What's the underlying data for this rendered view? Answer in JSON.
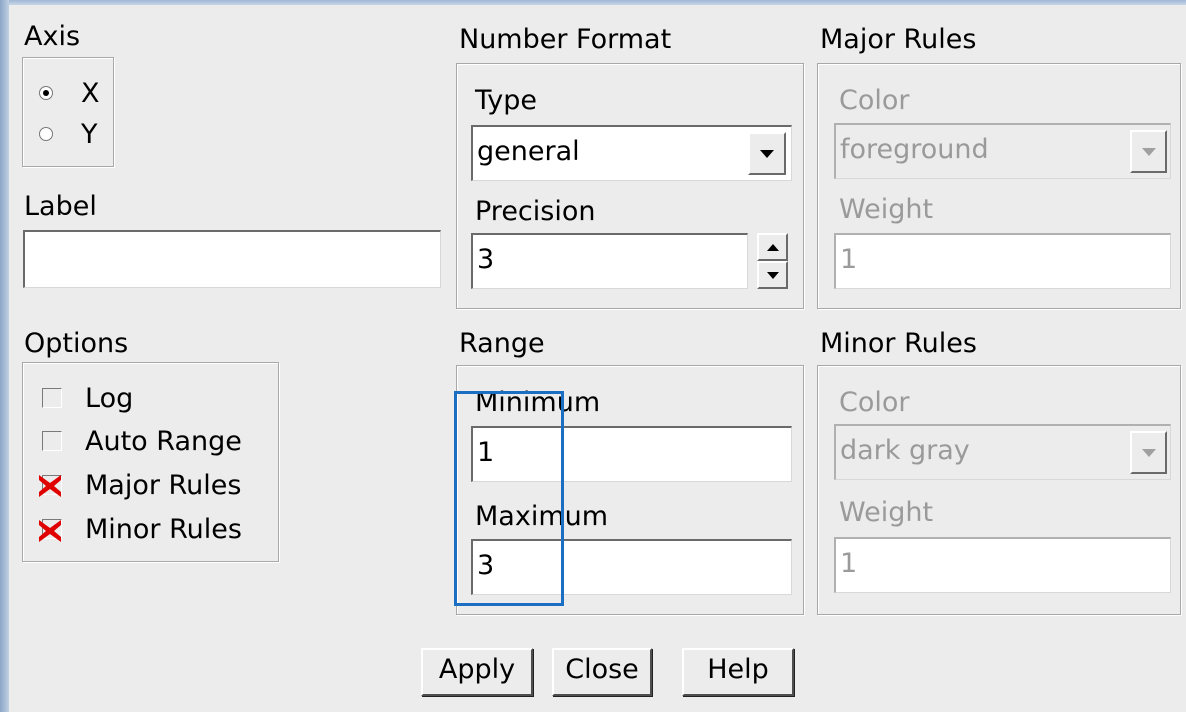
{
  "axis": {
    "title": "Axis",
    "options": [
      "X",
      "Y"
    ],
    "selected": "X"
  },
  "label": {
    "title": "Label",
    "value": ""
  },
  "number_format": {
    "title": "Number Format",
    "type_label": "Type",
    "type_value": "general",
    "precision_label": "Precision",
    "precision_value": "3"
  },
  "major_rules": {
    "title": "Major Rules",
    "color_label": "Color",
    "color_value": "foreground",
    "weight_label": "Weight",
    "weight_value": "1"
  },
  "options": {
    "title": "Options",
    "items": [
      {
        "label": "Log",
        "checked": false
      },
      {
        "label": "Auto Range",
        "checked": false
      },
      {
        "label": "Major Rules",
        "checked": true
      },
      {
        "label": "Minor Rules",
        "checked": true
      }
    ]
  },
  "range": {
    "title": "Range",
    "min_label": "Minimum",
    "min_value": "1",
    "max_label": "Maximum",
    "max_value": "3"
  },
  "minor_rules": {
    "title": "Minor Rules",
    "color_label": "Color",
    "color_value": "dark gray",
    "weight_label": "Weight",
    "weight_value": "1"
  },
  "buttons": {
    "apply": "Apply",
    "close": "Close",
    "help": "Help"
  },
  "colors": {
    "highlight": "#1a6fc4",
    "check_mark": "#e00000",
    "disabled_text": "#9a9a9a"
  }
}
